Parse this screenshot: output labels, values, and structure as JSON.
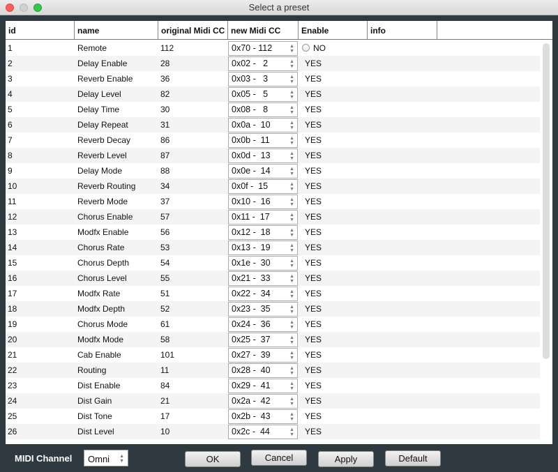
{
  "window": {
    "title": "Select a preset"
  },
  "columns": [
    "id",
    "name",
    "original Midi CC",
    "new Midi CC",
    "Enable",
    "info"
  ],
  "rows": [
    [
      "1",
      "Remote",
      "112",
      "0x70 - 112",
      "NO"
    ],
    [
      "2",
      "Delay Enable",
      "28",
      "0x02 -   2",
      "YES"
    ],
    [
      "3",
      "Reverb Enable",
      "36",
      "0x03 -   3",
      "YES"
    ],
    [
      "4",
      "Delay Level",
      "82",
      "0x05 -   5",
      "YES"
    ],
    [
      "5",
      "Delay Time",
      "30",
      "0x08 -   8",
      "YES"
    ],
    [
      "6",
      "Delay Repeat",
      "31",
      "0x0a -  10",
      "YES"
    ],
    [
      "7",
      "Reverb Decay",
      "86",
      "0x0b -  11",
      "YES"
    ],
    [
      "8",
      "Reverb Level",
      "87",
      "0x0d -  13",
      "YES"
    ],
    [
      "9",
      "Delay Mode",
      "88",
      "0x0e -  14",
      "YES"
    ],
    [
      "10",
      "Reverb Routing",
      "34",
      "0x0f -  15",
      "YES"
    ],
    [
      "11",
      "Reverb Mode",
      "37",
      "0x10 -  16",
      "YES"
    ],
    [
      "12",
      "Chorus Enable",
      "57",
      "0x11 -  17",
      "YES"
    ],
    [
      "13",
      "Modfx Enable",
      "56",
      "0x12 -  18",
      "YES"
    ],
    [
      "14",
      "Chorus Rate",
      "53",
      "0x13 -  19",
      "YES"
    ],
    [
      "15",
      "Chorus Depth",
      "54",
      "0x1e -  30",
      "YES"
    ],
    [
      "16",
      "Chorus Level",
      "55",
      "0x21 -  33",
      "YES"
    ],
    [
      "17",
      "Modfx Rate",
      "51",
      "0x22 -  34",
      "YES"
    ],
    [
      "18",
      "Modfx Depth",
      "52",
      "0x23 -  35",
      "YES"
    ],
    [
      "19",
      "Chorus Mode",
      "61",
      "0x24 -  36",
      "YES"
    ],
    [
      "20",
      "Modfx Mode",
      "58",
      "0x25 -  37",
      "YES"
    ],
    [
      "21",
      "Cab Enable",
      "101",
      "0x27 -  39",
      "YES"
    ],
    [
      "22",
      "Routing",
      "11",
      "0x28 -  40",
      "YES"
    ],
    [
      "23",
      "Dist Enable",
      "84",
      "0x29 -  41",
      "YES"
    ],
    [
      "24",
      "Dist Gain",
      "21",
      "0x2a -  42",
      "YES"
    ],
    [
      "25",
      "Dist Tone",
      "17",
      "0x2b -  43",
      "YES"
    ],
    [
      "26",
      "Dist Level",
      "10",
      "0x2c -  44",
      "YES"
    ]
  ],
  "footer": {
    "midi_channel_label": "MIDI Channel",
    "midi_channel_value": "Omni",
    "ok": "OK",
    "cancel": "Cancel",
    "apply": "Apply",
    "default": "Default"
  }
}
